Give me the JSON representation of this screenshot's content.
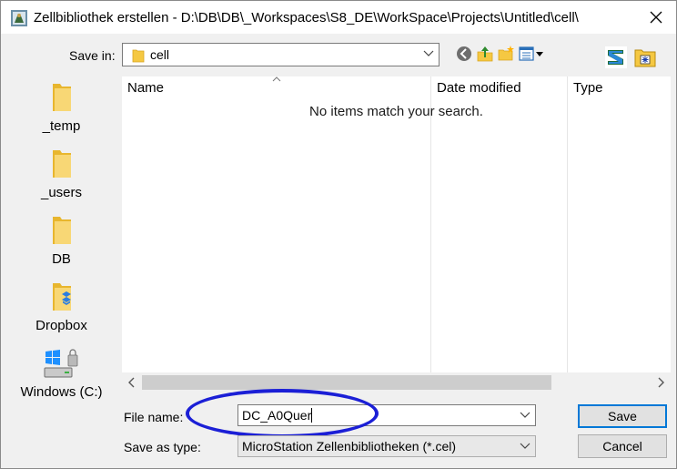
{
  "window": {
    "title": "Zellbibliothek erstellen - D:\\DB\\DB\\_Workspaces\\S8_DE\\WorkSpace\\Projects\\Untitled\\cell\\",
    "close_icon": "close-icon"
  },
  "save_in": {
    "label": "Save in:",
    "value": "cell"
  },
  "toolbar": {
    "icons": [
      "back-icon",
      "up-folder-icon",
      "new-folder-icon",
      "view-menu-icon",
      "microstation-icon",
      "folder-config-icon"
    ]
  },
  "places": [
    {
      "label": "_temp",
      "icon": "folder-icon"
    },
    {
      "label": "_users",
      "icon": "folder-icon"
    },
    {
      "label": "DB",
      "icon": "folder-icon"
    },
    {
      "label": "Dropbox",
      "icon": "dropbox-folder-icon"
    },
    {
      "label": "Windows (C:)",
      "icon": "drive-icon"
    }
  ],
  "file_list": {
    "columns": [
      "Name",
      "Date modified",
      "Type"
    ],
    "empty_message": "No items match your search."
  },
  "file_name": {
    "label": "File name:",
    "value": "DC_A0Quer"
  },
  "save_as_type": {
    "label": "Save as type:",
    "value": "MicroStation Zellenbibliotheken (*.cel)"
  },
  "buttons": {
    "save": "Save",
    "cancel": "Cancel"
  },
  "colors": {
    "highlight": "#1b1fd6",
    "folder": "#f5c842",
    "primary_border": "#0078d7"
  }
}
